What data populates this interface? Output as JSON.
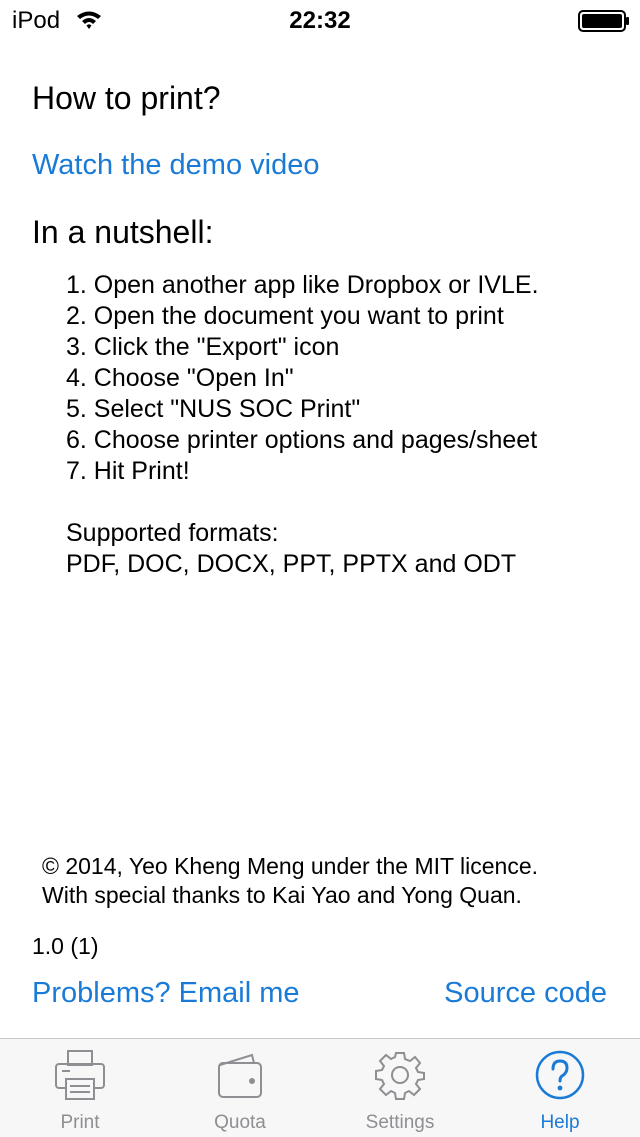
{
  "status_bar": {
    "carrier": "iPod",
    "time": "22:32"
  },
  "main": {
    "title": "How to print?",
    "demo_link": "Watch the demo video",
    "nutshell_heading": "In a nutshell:",
    "steps": [
      "1. Open another app like Dropbox or IVLE.",
      "2. Open the document you want to print",
      "3. Click the \"Export\" icon",
      "4. Choose \"Open In\"",
      "5. Select \"NUS SOC Print\"",
      "6. Choose printer options and pages/sheet",
      "7. Hit Print!"
    ],
    "formats_label": "Supported formats:",
    "formats_list": "PDF, DOC, DOCX, PPT, PPTX and ODT"
  },
  "footer": {
    "copyright": "© 2014, Yeo Kheng Meng under the MIT licence.",
    "thanks": "With special thanks to Kai Yao and Yong Quan.",
    "version": "1.0 (1)",
    "problems_link": "Problems? Email me",
    "source_link": "Source code"
  },
  "tab_bar": {
    "tabs": [
      {
        "label": "Print",
        "icon": "printer-icon",
        "active": false
      },
      {
        "label": "Quota",
        "icon": "wallet-icon",
        "active": false
      },
      {
        "label": "Settings",
        "icon": "gear-icon",
        "active": false
      },
      {
        "label": "Help",
        "icon": "help-icon",
        "active": true
      }
    ]
  },
  "colors": {
    "accent": "#1a7bd6",
    "inactive_tab": "#8e8e93",
    "tab_bar_bg": "#f7f7f7"
  }
}
